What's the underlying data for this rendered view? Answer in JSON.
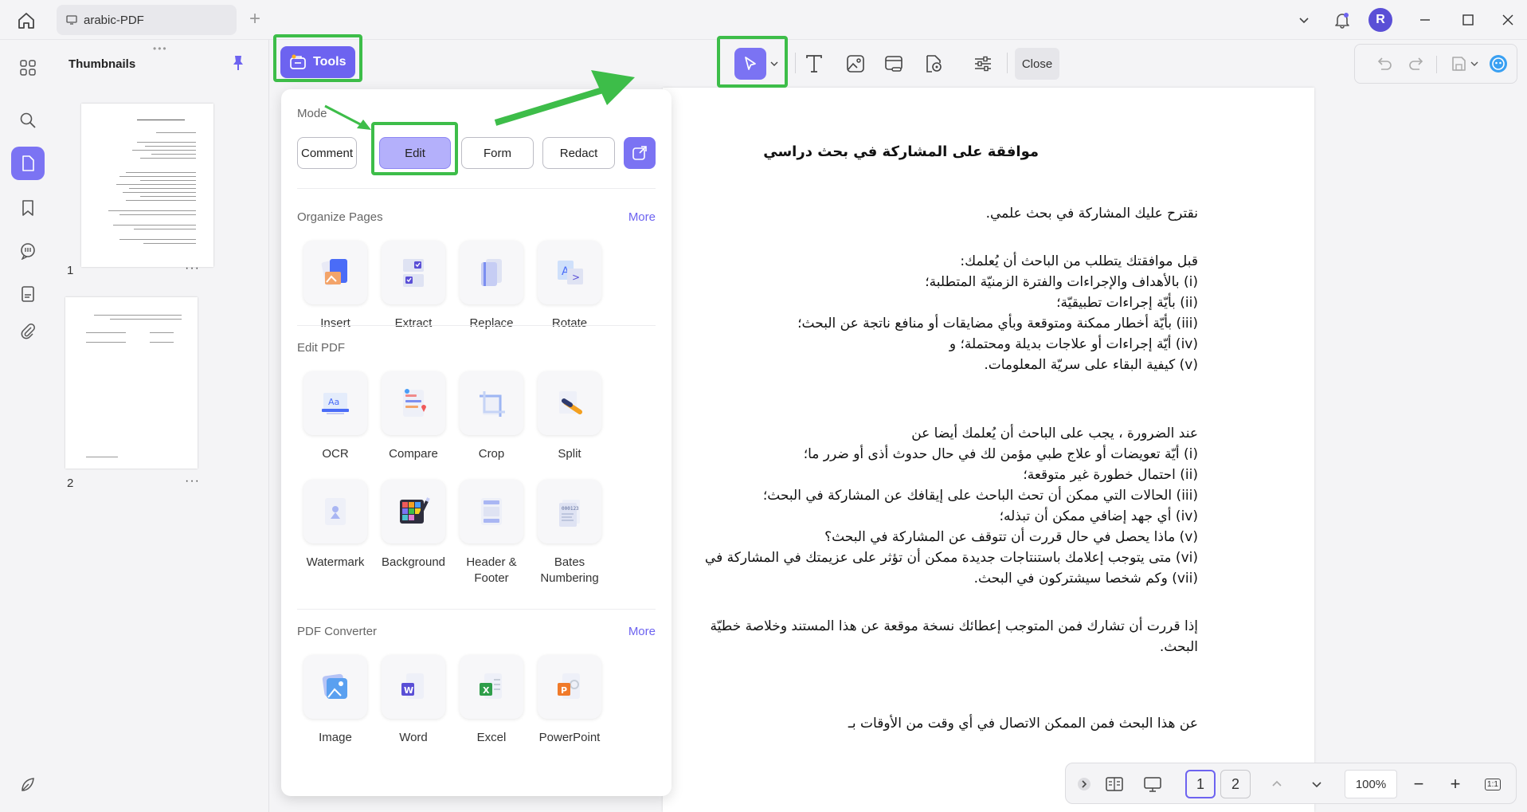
{
  "titlebar": {
    "tab_title": "arabic-PDF",
    "add_tab": "+",
    "avatar_initial": "R"
  },
  "thumbnails": {
    "title": "Thumbnails",
    "pages": [
      {
        "number": "1",
        "more": "···"
      },
      {
        "number": "2",
        "more": "···"
      }
    ]
  },
  "tools": {
    "label": "Tools"
  },
  "toolbar": {
    "close_label": "Close"
  },
  "dropdown": {
    "mode_title": "Mode",
    "modes": [
      {
        "label": "Comment",
        "active": false
      },
      {
        "label": "Edit",
        "active": true
      },
      {
        "label": "Form",
        "active": false
      },
      {
        "label": "Redact",
        "active": false
      }
    ],
    "organize": {
      "title": "Organize Pages",
      "more": "More",
      "items": [
        "Insert",
        "Extract",
        "Replace",
        "Rotate"
      ]
    },
    "edit_pdf": {
      "title": "Edit PDF",
      "items": [
        "OCR",
        "Compare",
        "Crop",
        "Split",
        "Watermark",
        "Background",
        "Header & Footer",
        "Bates Numbering"
      ]
    },
    "converter": {
      "title": "PDF Converter",
      "more": "More",
      "items": [
        "Image",
        "Word",
        "Excel",
        "PowerPoint"
      ]
    }
  },
  "document": {
    "title": "موافقة على المشاركة في بحث دراسي",
    "intro": "نقترح عليك المشاركة في بحث علمي.",
    "block1_head": "قبل موافقتك يتطلب من الباحث أن يُعلمك:",
    "block1": [
      "(i) بالأهداف والإجراءات والفترة الزمنيّة المتطلبة؛",
      "(ii) بأيّة إجراءات تطبيقيّة؛",
      "(iii) بأيّة أخطار ممكنة ومتوقعة وبأي مضايقات أو منافع ناتجة عن البحث؛",
      "(iv) أيّة إجراءات أو علاجات بديلة ومحتملة؛ و",
      "(v) كيفية البقاء على سريّة المعلومات."
    ],
    "block2_head": "عند الضرورة ، يجب على الباحث أن يُعلمك أيضا عن",
    "block2": [
      "(i) أيّة تعويضات أو علاج طبي مؤمن لك في حال حدوث أذى أو ضرر ما؛",
      "(ii) احتمال خطورة غير متوقعة؛",
      "(iii) الحالات التي ممكن أن تحث الباحث على إيقافك عن المشاركة في البحث؛",
      "(iv) أي جهد إضافي ممكن أن تبذله؛",
      "(v) ماذا يحصل في حال قررت أن تتوقف عن المشاركة في البحث؟",
      "(vi) متى يتوجب إعلامك باستنتاجات جديدة ممكن أن تؤثر على عزيمتك في المشاركة في",
      "(vii) وكم شخصا سيشتركون في البحث."
    ],
    "block3_line1": "إذا قررت أن تشارك فمن المتوجب إعطائك نسخة موقعة عن هذا المستند وخلاصة خطيّة",
    "block3_line2": "البحث.",
    "block4_line1": "عن هذا البحث فمن الممكن الاتصال في أي وقت من الأوقات بـ"
  },
  "bottom_bar": {
    "pages": [
      "1",
      "2"
    ],
    "current_page": "1",
    "zoom": "100%",
    "zoom_out": "−",
    "zoom_in": "+",
    "fit": "1:1"
  },
  "colors": {
    "accent": "#6d63f0",
    "annotation_green": "#3dbd49"
  }
}
